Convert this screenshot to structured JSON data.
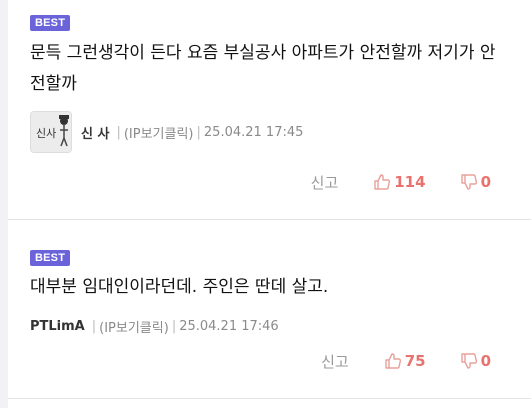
{
  "comments": [
    {
      "badge": "BEST",
      "text": "문득 그런생각이 든다 요즘 부실공사 아파트가 안전할까 저기가 안전할까",
      "author": "신 사",
      "ip_label": "(IP보기클릭)",
      "date": "25.04.21 17:45",
      "avatar_text": "신사",
      "report_label": "신고",
      "likes": "114",
      "dislikes": "0"
    },
    {
      "badge": "BEST",
      "text": "대부분 임대인이라던데. 주인은 딴데 살고.",
      "author": "PTLimA",
      "ip_label": "(IP보기클릭)",
      "date": "25.04.21 17:46",
      "report_label": "신고",
      "likes": "75",
      "dislikes": "0"
    }
  ],
  "separator": "|",
  "colors": {
    "badge": "#6b63d9",
    "count": "#e8736e",
    "icon": "#e8a09a"
  },
  "icons": {
    "like": "thumbs-up-icon",
    "dislike": "thumbs-down-icon"
  }
}
